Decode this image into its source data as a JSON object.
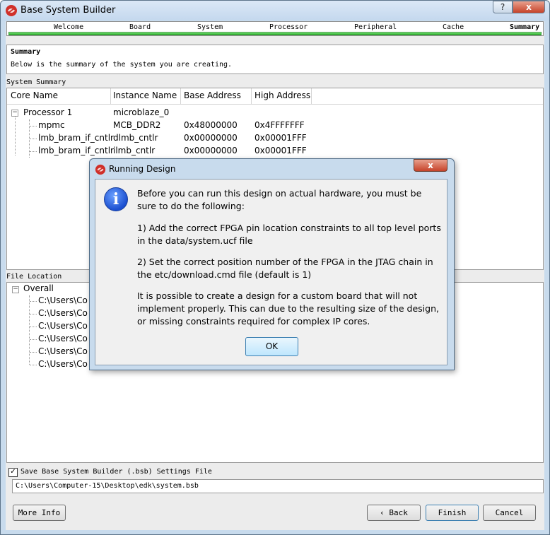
{
  "window": {
    "title": "Base System Builder",
    "help_label": "?",
    "close_label": "x"
  },
  "steps": [
    "Welcome",
    "Board",
    "System",
    "Processor",
    "Peripheral",
    "Cache",
    "Summary"
  ],
  "summary": {
    "title": "Summary",
    "description": "Below is the summary of the system you are creating."
  },
  "system_summary": {
    "label": "System Summary",
    "columns": [
      "Core Name",
      "Instance Name",
      "Base Address",
      "High Address"
    ],
    "rows": [
      {
        "core": "Processor 1",
        "instance": "microblaze_0",
        "base": "",
        "high": ""
      },
      {
        "core": "mpmc",
        "instance": "MCB_DDR2",
        "base": "0x48000000",
        "high": "0x4FFFFFFF"
      },
      {
        "core": "lmb_bram_if_cntlr",
        "instance": "dlmb_cntlr",
        "base": "0x00000000",
        "high": "0x00001FFF"
      },
      {
        "core": "lmb_bram_if_cntlr",
        "instance": "ilmb_cntlr",
        "base": "0x00000000",
        "high": "0x00001FFF"
      }
    ]
  },
  "file_location": {
    "label": "File Location",
    "root": "Overall",
    "items": [
      "C:\\Users\\Co",
      "C:\\Users\\Co",
      "C:\\Users\\Co",
      "C:\\Users\\Co",
      "C:\\Users\\Co",
      "C:\\Users\\Co"
    ]
  },
  "settings": {
    "checkbox_label": "Save Base System Builder (.bsb) Settings File",
    "checked": true,
    "path": "C:\\Users\\Computer-15\\Desktop\\edk\\system.bsb"
  },
  "buttons": {
    "more_info": "More Info",
    "back": "Back",
    "finish": "Finish",
    "cancel": "Cancel"
  },
  "dialog": {
    "title": "Running Design",
    "close_label": "x",
    "icon": "info-icon",
    "paragraph1": "Before you can run this design on actual hardware, you must be sure to do the following:",
    "paragraph2": "1) Add the correct FPGA pin location constraints to all top level ports in the data/system.ucf file",
    "paragraph3": "2) Set the correct position number of the FPGA in the JTAG chain in the etc/download.cmd file (default is 1)",
    "paragraph4": "It is possible to create a design for a custom board that will not implement properly. This can due to the resulting size of the design, or missing constraints required for complex IP cores.",
    "ok_label": "OK"
  },
  "colors": {
    "progress": "#46c846",
    "titlebar": "#c4d8ee",
    "close": "#c7432a"
  }
}
